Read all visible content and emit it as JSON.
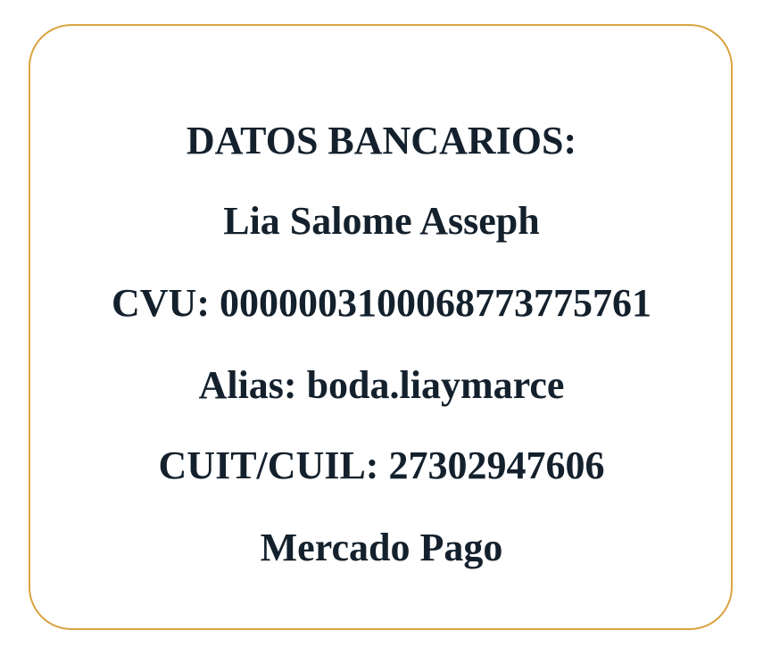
{
  "card": {
    "border_color": "#d9a441",
    "text_color": "#14212d",
    "title": "DATOS BANCARIOS:",
    "name": "Lia Salome Asseph",
    "cvu": "CVU: 0000003100068773775761",
    "alias": "Alias: boda.liaymarce",
    "cuit": "CUIT/CUIL: 27302947606",
    "provider": "Mercado Pago"
  }
}
